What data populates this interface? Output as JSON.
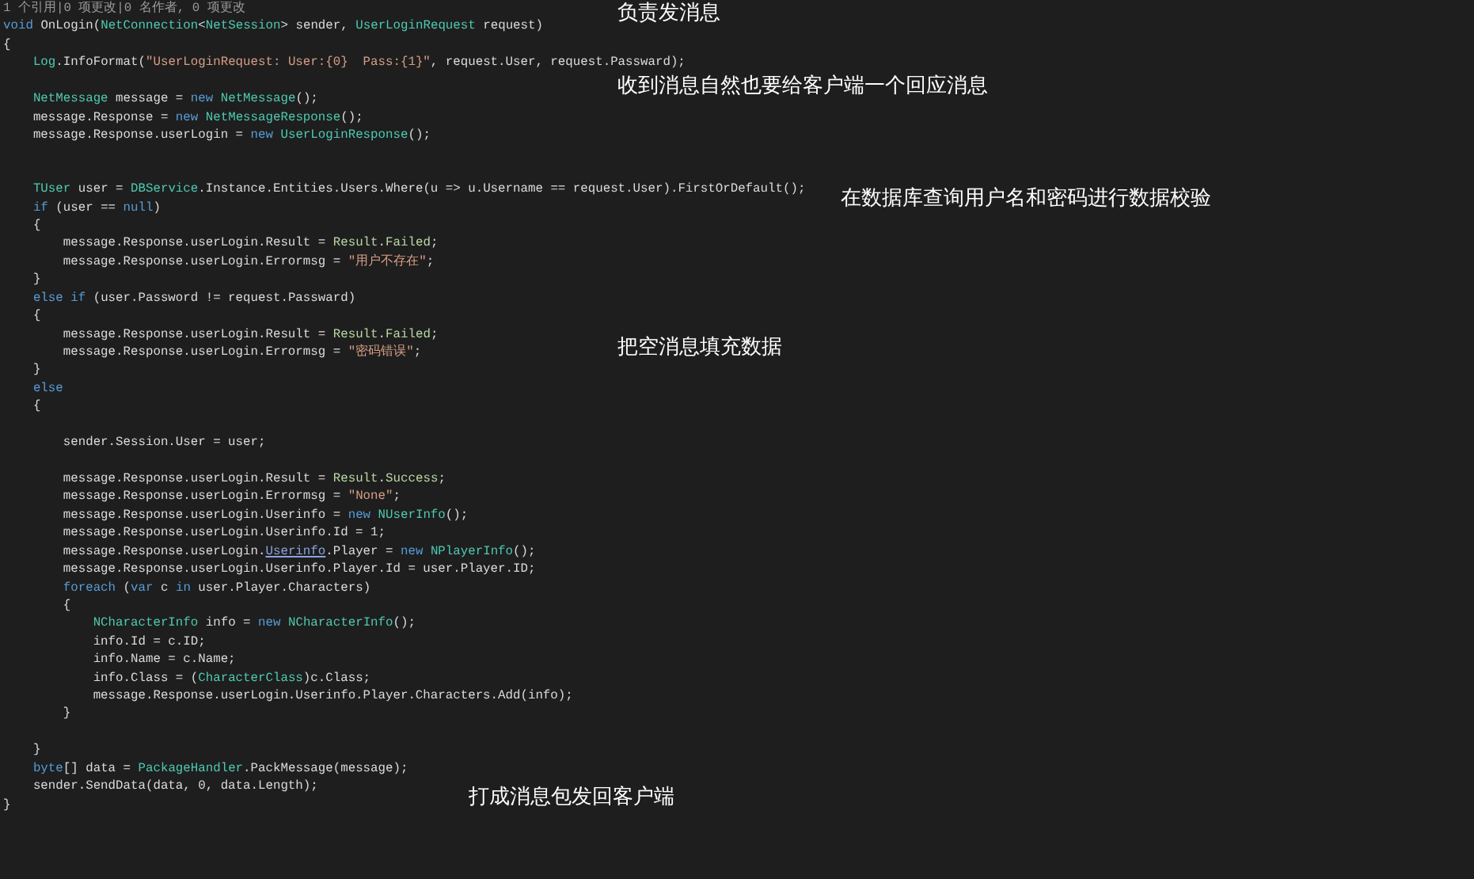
{
  "code_lines": [
    {
      "kind": "code",
      "tokens": [
        {
          "text": "1 个引用|0 项更改|0 名作者, 0 项更改",
          "kind": "lens"
        }
      ]
    },
    {
      "kind": "code",
      "tokens": [
        {
          "text": "void",
          "kind": "keyword"
        },
        {
          "text": " OnLogin(",
          "kind": "plain"
        },
        {
          "text": "NetConnection",
          "kind": "type"
        },
        {
          "text": "<",
          "kind": "plain"
        },
        {
          "text": "NetSession",
          "kind": "type"
        },
        {
          "text": "> sender, ",
          "kind": "plain"
        },
        {
          "text": "UserLoginRequest",
          "kind": "type"
        },
        {
          "text": " request)",
          "kind": "plain"
        }
      ]
    },
    {
      "kind": "code",
      "tokens": [
        {
          "text": "{",
          "kind": "plain"
        }
      ]
    },
    {
      "kind": "code",
      "tokens": [
        {
          "text": "    Log",
          "kind": "type"
        },
        {
          "text": ".InfoFormat(",
          "kind": "plain"
        },
        {
          "text": "\"UserLoginRequest: User:{0}  Pass:{1}\"",
          "kind": "string"
        },
        {
          "text": ", request.User, request.Passward);",
          "kind": "plain"
        }
      ]
    },
    {
      "kind": "blank"
    },
    {
      "kind": "code",
      "tokens": [
        {
          "text": "    NetMessage",
          "kind": "type"
        },
        {
          "text": " message = ",
          "kind": "plain"
        },
        {
          "text": "new ",
          "kind": "keyword"
        },
        {
          "text": "NetMessage",
          "kind": "type"
        },
        {
          "text": "();",
          "kind": "plain"
        }
      ]
    },
    {
      "kind": "code",
      "tokens": [
        {
          "text": "    message.Response = ",
          "kind": "plain"
        },
        {
          "text": "new ",
          "kind": "keyword"
        },
        {
          "text": "NetMessageResponse",
          "kind": "type"
        },
        {
          "text": "();",
          "kind": "plain"
        }
      ]
    },
    {
      "kind": "code",
      "tokens": [
        {
          "text": "    message.Response.userLogin = ",
          "kind": "plain"
        },
        {
          "text": "new ",
          "kind": "keyword"
        },
        {
          "text": "UserLoginResponse",
          "kind": "type"
        },
        {
          "text": "();",
          "kind": "plain"
        }
      ]
    },
    {
      "kind": "blank"
    },
    {
      "kind": "blank"
    },
    {
      "kind": "code",
      "tokens": [
        {
          "text": "    TUser",
          "kind": "type"
        },
        {
          "text": " user = ",
          "kind": "plain"
        },
        {
          "text": "DBService",
          "kind": "type"
        },
        {
          "text": ".Instance.Entities.Users.Where(u => u.Username == request.User).FirstOrDefault();",
          "kind": "plain"
        }
      ]
    },
    {
      "kind": "code",
      "tokens": [
        {
          "text": "    if",
          "kind": "keyword"
        },
        {
          "text": " (user == ",
          "kind": "plain"
        },
        {
          "text": "null",
          "kind": "keyword"
        },
        {
          "text": ")",
          "kind": "plain"
        }
      ]
    },
    {
      "kind": "code",
      "tokens": [
        {
          "text": "    {",
          "kind": "plain"
        }
      ]
    },
    {
      "kind": "code",
      "tokens": [
        {
          "text": "        message.Response.userLogin.Result = ",
          "kind": "plain"
        },
        {
          "text": "Result",
          "kind": "enum"
        },
        {
          "text": ".",
          "kind": "plain"
        },
        {
          "text": "Failed",
          "kind": "enum"
        },
        {
          "text": ";",
          "kind": "plain"
        }
      ]
    },
    {
      "kind": "code",
      "tokens": [
        {
          "text": "        message.Response.userLogin.Errormsg = ",
          "kind": "plain"
        },
        {
          "text": "\"用户不存在\"",
          "kind": "string"
        },
        {
          "text": ";",
          "kind": "plain"
        }
      ]
    },
    {
      "kind": "code",
      "tokens": [
        {
          "text": "    }",
          "kind": "plain"
        }
      ]
    },
    {
      "kind": "code",
      "tokens": [
        {
          "text": "    else if",
          "kind": "keyword"
        },
        {
          "text": " (user.Password != request.Passward)",
          "kind": "plain"
        }
      ]
    },
    {
      "kind": "code",
      "tokens": [
        {
          "text": "    {",
          "kind": "plain"
        }
      ]
    },
    {
      "kind": "code",
      "tokens": [
        {
          "text": "        message.Response.userLogin.Result = ",
          "kind": "plain"
        },
        {
          "text": "Result",
          "kind": "enum"
        },
        {
          "text": ".",
          "kind": "plain"
        },
        {
          "text": "Failed",
          "kind": "enum"
        },
        {
          "text": ";",
          "kind": "plain"
        }
      ]
    },
    {
      "kind": "code",
      "tokens": [
        {
          "text": "        message.Response.userLogin.Errormsg = ",
          "kind": "plain"
        },
        {
          "text": "\"密码错误\"",
          "kind": "string"
        },
        {
          "text": ";",
          "kind": "plain"
        }
      ]
    },
    {
      "kind": "code",
      "tokens": [
        {
          "text": "    }",
          "kind": "plain"
        }
      ]
    },
    {
      "kind": "code",
      "tokens": [
        {
          "text": "    else",
          "kind": "keyword"
        }
      ]
    },
    {
      "kind": "code",
      "tokens": [
        {
          "text": "    {",
          "kind": "plain"
        }
      ]
    },
    {
      "kind": "blank"
    },
    {
      "kind": "code",
      "tokens": [
        {
          "text": "        sender.Session.User = user;",
          "kind": "plain"
        }
      ]
    },
    {
      "kind": "blank"
    },
    {
      "kind": "code",
      "tokens": [
        {
          "text": "        message.Response.userLogin.Result = ",
          "kind": "plain"
        },
        {
          "text": "Result",
          "kind": "enum"
        },
        {
          "text": ".",
          "kind": "plain"
        },
        {
          "text": "Success",
          "kind": "enum"
        },
        {
          "text": ";",
          "kind": "plain"
        }
      ]
    },
    {
      "kind": "code",
      "tokens": [
        {
          "text": "        message.Response.userLogin.Errormsg = ",
          "kind": "plain"
        },
        {
          "text": "\"None\"",
          "kind": "string"
        },
        {
          "text": ";",
          "kind": "plain"
        }
      ]
    },
    {
      "kind": "code",
      "tokens": [
        {
          "text": "        message.Response.userLogin.Userinfo = ",
          "kind": "plain"
        },
        {
          "text": "new ",
          "kind": "keyword"
        },
        {
          "text": "NUserInfo",
          "kind": "type"
        },
        {
          "text": "();",
          "kind": "plain"
        }
      ]
    },
    {
      "kind": "code",
      "tokens": [
        {
          "text": "        message.Response.userLogin.Userinfo.Id = 1;",
          "kind": "plain"
        }
      ]
    },
    {
      "kind": "code",
      "tokens": [
        {
          "text": "        message.Response.userLogin.",
          "kind": "plain"
        },
        {
          "text": "Userinfo",
          "kind": "link"
        },
        {
          "text": ".Player = ",
          "kind": "plain"
        },
        {
          "text": "new ",
          "kind": "keyword"
        },
        {
          "text": "NPlayerInfo",
          "kind": "type"
        },
        {
          "text": "();",
          "kind": "plain"
        }
      ]
    },
    {
      "kind": "code",
      "tokens": [
        {
          "text": "        message.Response.userLogin.Userinfo.Player.Id = user.Player.ID;",
          "kind": "plain"
        }
      ]
    },
    {
      "kind": "code",
      "tokens": [
        {
          "text": "        foreach",
          "kind": "keyword"
        },
        {
          "text": " (",
          "kind": "plain"
        },
        {
          "text": "var",
          "kind": "keyword"
        },
        {
          "text": " c ",
          "kind": "plain"
        },
        {
          "text": "in",
          "kind": "keyword"
        },
        {
          "text": " user.Player.Characters)",
          "kind": "plain"
        }
      ]
    },
    {
      "kind": "code",
      "tokens": [
        {
          "text": "        {",
          "kind": "plain"
        }
      ]
    },
    {
      "kind": "code",
      "tokens": [
        {
          "text": "            NCharacterInfo",
          "kind": "type"
        },
        {
          "text": " info = ",
          "kind": "plain"
        },
        {
          "text": "new ",
          "kind": "keyword"
        },
        {
          "text": "NCharacterInfo",
          "kind": "type"
        },
        {
          "text": "();",
          "kind": "plain"
        }
      ]
    },
    {
      "kind": "code",
      "tokens": [
        {
          "text": "            info.Id = c.ID;",
          "kind": "plain"
        }
      ]
    },
    {
      "kind": "code",
      "tokens": [
        {
          "text": "            info.Name = c.Name;",
          "kind": "plain"
        }
      ]
    },
    {
      "kind": "code",
      "tokens": [
        {
          "text": "            info.Class = (",
          "kind": "plain"
        },
        {
          "text": "CharacterClass",
          "kind": "type"
        },
        {
          "text": ")c.Class;",
          "kind": "plain"
        }
      ]
    },
    {
      "kind": "code",
      "tokens": [
        {
          "text": "            message.Response.userLogin.Userinfo.Player.Characters.Add(info);",
          "kind": "plain"
        }
      ]
    },
    {
      "kind": "code",
      "tokens": [
        {
          "text": "        }",
          "kind": "plain"
        }
      ]
    },
    {
      "kind": "blank"
    },
    {
      "kind": "code",
      "tokens": [
        {
          "text": "    }",
          "kind": "plain"
        }
      ]
    },
    {
      "kind": "code",
      "tokens": [
        {
          "text": "    byte",
          "kind": "keyword"
        },
        {
          "text": "[] data = ",
          "kind": "plain"
        },
        {
          "text": "PackageHandler",
          "kind": "type"
        },
        {
          "text": ".PackMessage(message);",
          "kind": "plain"
        }
      ]
    },
    {
      "kind": "code",
      "tokens": [
        {
          "text": "    sender.SendData(data, 0, data.Length);",
          "kind": "plain"
        }
      ]
    },
    {
      "kind": "code",
      "tokens": [
        {
          "text": "}",
          "kind": "plain"
        }
      ]
    }
  ],
  "annotations": [
    "负责发消息",
    "收到消息自然也要给客户端一个回应消息",
    "在数据库查询用户名和密码进行数据校验",
    "把空消息填充数据",
    "打成消息包发回客户端"
  ]
}
